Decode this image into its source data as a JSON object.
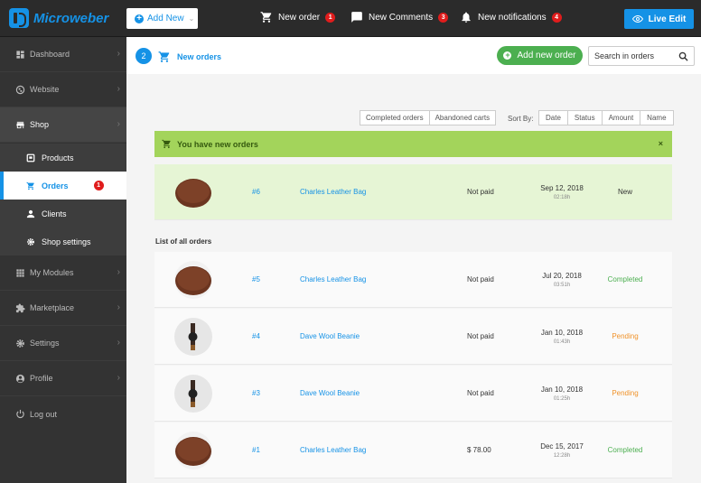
{
  "app": {
    "brand": "Microweber",
    "add_new_label": "Add New",
    "live_edit_label": "Live Edit"
  },
  "topnav": [
    {
      "label": "New order",
      "count": "1",
      "icon": "cart-icon"
    },
    {
      "label": "New Comments",
      "count": "3",
      "icon": "comment-icon"
    },
    {
      "label": "New notifications",
      "count": "4",
      "icon": "bell-icon"
    }
  ],
  "sidebar": {
    "items": [
      {
        "label": "Dashboard",
        "icon": "dashboard-icon"
      },
      {
        "label": "Website",
        "icon": "globe-icon"
      },
      {
        "label": "Shop",
        "icon": "shop-icon"
      },
      {
        "label": "My Modules",
        "icon": "modules-icon"
      },
      {
        "label": "Marketplace",
        "icon": "puzzle-icon"
      },
      {
        "label": "Settings",
        "icon": "gear-icon"
      },
      {
        "label": "Profile",
        "icon": "user-icon"
      },
      {
        "label": "Log out",
        "icon": "power-icon"
      }
    ],
    "shop_sub": [
      {
        "label": "Products",
        "icon": "products-icon"
      },
      {
        "label": "Orders",
        "icon": "cart-icon",
        "badge": "1"
      },
      {
        "label": "Clients",
        "icon": "person-icon"
      },
      {
        "label": "Shop settings",
        "icon": "gear-icon"
      }
    ]
  },
  "header": {
    "step": "2",
    "title": "New orders",
    "add_order_label": "Add new order",
    "search_placeholder": "Search in orders"
  },
  "filters": {
    "completed_label": "Completed orders",
    "abandoned_label": "Abandoned carts",
    "sort_by_label": "Sort By:",
    "sort_options": [
      "Date",
      "Status",
      "Amount",
      "Name"
    ]
  },
  "new_banner": {
    "text": "You have new orders",
    "close": "×"
  },
  "new_orders": [
    {
      "id": "#6",
      "name": "Charles Leather Bag",
      "payment": "Not paid",
      "date": "Sep 12, 2018",
      "time": "02:18h",
      "status": "New",
      "status_color": "#333333",
      "thumb": "bag"
    }
  ],
  "list_title": "List of all orders",
  "orders": [
    {
      "id": "#5",
      "name": "Charles Leather Bag",
      "payment": "Not paid",
      "date": "Jul 20, 2018",
      "time": "03:51h",
      "status": "Completed",
      "status_color": "#4caf50",
      "thumb": "bag"
    },
    {
      "id": "#4",
      "name": "Dave Wool Beanie",
      "payment": "Not paid",
      "date": "Jan 10, 2018",
      "time": "01:43h",
      "status": "Pending",
      "status_color": "#f0932b",
      "thumb": "watch"
    },
    {
      "id": "#3",
      "name": "Dave Wool Beanie",
      "payment": "Not paid",
      "date": "Jan 10, 2018",
      "time": "01:25h",
      "status": "Pending",
      "status_color": "#f0932b",
      "thumb": "watch"
    },
    {
      "id": "#1",
      "name": "Charles Leather Bag",
      "payment": "$ 78.00",
      "date": "Dec 15, 2017",
      "time": "12:28h",
      "status": "Completed",
      "status_color": "#4caf50",
      "thumb": "bag"
    }
  ],
  "colors": {
    "accent": "#1592e6",
    "success": "#4caf50",
    "pending": "#f0932b",
    "badge": "#e01c1c",
    "new_banner": "#a3d45b"
  }
}
